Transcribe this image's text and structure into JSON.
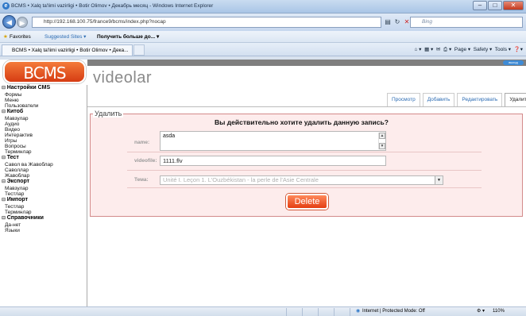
{
  "window": {
    "title": "BCMS • Xalq ta'limi vazirligi • Botir Olimov • Декабрь месяц - Windows Internet Explorer"
  },
  "browser": {
    "url": "http://192.168.100.75/france9/bcms/index.php?nocap",
    "search_placeholder": "Bing",
    "favorites": {
      "label": "Favorites",
      "suggested": "Suggested Sites ▾",
      "more": "Получить больше до... ▾"
    },
    "tab_title": "BCMS • Xalq ta'limi vazirligi • Botir Olimov • Дека...",
    "commands": {
      "page": "Page ▾",
      "safety": "Safety ▾",
      "tools": "Tools ▾"
    },
    "status": {
      "zone": "Internet | Protected Mode: Off",
      "zoom": "110%"
    }
  },
  "app": {
    "logo": "BCMS",
    "logout": "выход",
    "page_title": "videolar"
  },
  "sidebar": {
    "sections": [
      {
        "head": "Настройки CMS",
        "items": [
          "Формы",
          "Меню",
          "Пользователи"
        ]
      },
      {
        "head": "Китоб",
        "items": [
          "Мавзулар",
          "Аудио",
          "Видео",
          "Интерактив",
          "Игры",
          "Вопросы",
          "Терминлар"
        ]
      },
      {
        "head": "Тест",
        "items": [
          "Савол ва Жавоблар",
          "Саволлар",
          "Жавоблар"
        ]
      },
      {
        "head": "Экспорт",
        "items": [
          "Мавзулар",
          "Тестлар"
        ]
      },
      {
        "head": "Импорт",
        "items": [
          "Тестлар",
          "Терминлар"
        ]
      },
      {
        "head": "Справочники",
        "items": [
          "Да-нет",
          "Языки"
        ]
      }
    ]
  },
  "tabs": [
    "Просмотр",
    "Добавить",
    "Редактировать",
    "Удалить"
  ],
  "form": {
    "legend": "Удалить",
    "question": "Вы действительно хотите удалить данную запись?",
    "name_label": "name:",
    "name_value": "asda",
    "file_label": "videofile:",
    "file_value": "1111.flv",
    "theme_label": "Тема:",
    "theme_value": "Unité I. Leçon 1. L'Ouzbékistan - la perle de l'Asie Centrale",
    "delete_label": "Delete"
  }
}
